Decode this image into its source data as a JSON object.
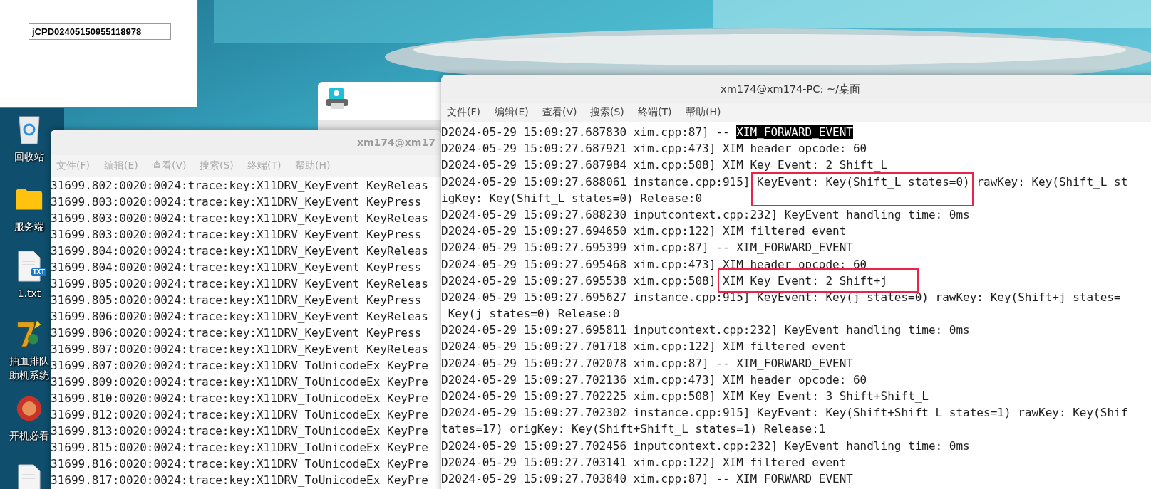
{
  "background_window": {
    "field": {
      "value": "jCPD02405150955118978"
    }
  },
  "desktop_icons": [
    {
      "kind": "trash",
      "label_lines": [
        "回收站"
      ]
    },
    {
      "kind": "folder",
      "label_lines": [
        "服务端"
      ]
    },
    {
      "kind": "txt",
      "badge": "TXT",
      "label_lines": [
        "1.txt"
      ]
    },
    {
      "kind": "app",
      "label_lines": [
        "抽血排队",
        "助机系统"
      ]
    },
    {
      "kind": "badge",
      "label_lines": [
        "开机必看"
      ]
    },
    {
      "kind": "txt"
    }
  ],
  "terminals": [
    {
      "title": "xm174@xm17",
      "active": false,
      "menu": [
        "文件(F)",
        "编辑(E)",
        "查看(V)",
        "搜索(S)",
        "终端(T)",
        "帮助(H)"
      ],
      "lines": [
        {
          "text": "31699.802:0020:0024:trace:key:X11DRV_KeyEvent KeyReleas"
        },
        {
          "text": "31699.803:0020:0024:trace:key:X11DRV_KeyEvent KeyPress"
        },
        {
          "text": "31699.803:0020:0024:trace:key:X11DRV_KeyEvent KeyReleas"
        },
        {
          "text": "31699.803:0020:0024:trace:key:X11DRV_KeyEvent KeyPress"
        },
        {
          "text": "31699.804:0020:0024:trace:key:X11DRV_KeyEvent KeyReleas"
        },
        {
          "text": "31699.804:0020:0024:trace:key:X11DRV_KeyEvent KeyPress"
        },
        {
          "text": "31699.805:0020:0024:trace:key:X11DRV_KeyEvent KeyReleas"
        },
        {
          "text": "31699.805:0020:0024:trace:key:X11DRV_KeyEvent KeyPress"
        },
        {
          "text": "31699.806:0020:0024:trace:key:X11DRV_KeyEvent KeyReleas"
        },
        {
          "text": "31699.806:0020:0024:trace:key:X11DRV_KeyEvent KeyPress"
        },
        {
          "text": "31699.807:0020:0024:trace:key:X11DRV_KeyEvent KeyReleas"
        },
        {
          "text": "31699.807:0020:0024:trace:key:X11DRV_ToUnicodeEx KeyPre"
        },
        {
          "text": "31699.809:0020:0024:trace:key:X11DRV_ToUnicodeEx KeyPre"
        },
        {
          "text": "31699.810:0020:0024:trace:key:X11DRV_ToUnicodeEx KeyPre"
        },
        {
          "text": "31699.812:0020:0024:trace:key:X11DRV_ToUnicodeEx KeyPre"
        },
        {
          "text": "31699.813:0020:0024:trace:key:X11DRV_ToUnicodeEx KeyPre"
        },
        {
          "text": "31699.815:0020:0024:trace:key:X11DRV_ToUnicodeEx KeyPre"
        },
        {
          "text": "31699.816:0020:0024:trace:key:X11DRV_ToUnicodeEx KeyPre"
        },
        {
          "text": "31699.817:0020:0024:trace:key:X11DRV_ToUnicodeEx KeyPre"
        }
      ]
    },
    {
      "title": "xm174@xm174-PC: ~/桌面",
      "active": true,
      "menu": [
        "文件(F)",
        "编辑(E)",
        "查看(V)",
        "搜索(S)",
        "终端(T)",
        "帮助(H)"
      ],
      "lines": [
        {
          "text": "D2024-05-29 15:09:27.687830 xim.cpp:87] -- ",
          "selection": "XIM_FORWARD_EVENT"
        },
        {
          "text": "D2024-05-29 15:09:27.687921 xim.cpp:473] XIM header opcode: 60"
        },
        {
          "text": "D2024-05-29 15:09:27.687984 xim.cpp:508] XIM Key Event: 2 Shift_L"
        },
        {
          "text": "D2024-05-29 15:09:27.688061 instance.cpp:915] KeyEvent: Key(Shift_L states=0) rawKey: Key(Shift_L st"
        },
        {
          "text": "igKey: Key(Shift_L states=0) Release:0"
        },
        {
          "text": "D2024-05-29 15:09:27.688230 inputcontext.cpp:232] KeyEvent handling time: 0ms"
        },
        {
          "text": "D2024-05-29 15:09:27.694650 xim.cpp:122] XIM filtered event"
        },
        {
          "text": "D2024-05-29 15:09:27.695399 xim.cpp:87] -- XIM_FORWARD_EVENT"
        },
        {
          "text": "D2024-05-29 15:09:27.695468 xim.cpp:473] XIM header opcode: 60"
        },
        {
          "text": "D2024-05-29 15:09:27.695538 xim.cpp:508] XIM Key Event: 2 Shift+j"
        },
        {
          "text": "D2024-05-29 15:09:27.695627 instance.cpp:915] KeyEvent: Key(j states=0) rawKey: Key(Shift+j states="
        },
        {
          "text": " Key(j states=0) Release:0"
        },
        {
          "text": "D2024-05-29 15:09:27.695811 inputcontext.cpp:232] KeyEvent handling time: 0ms"
        },
        {
          "text": "D2024-05-29 15:09:27.701718 xim.cpp:122] XIM filtered event"
        },
        {
          "text": "D2024-05-29 15:09:27.702078 xim.cpp:87] -- XIM_FORWARD_EVENT"
        },
        {
          "text": "D2024-05-29 15:09:27.702136 xim.cpp:473] XIM header opcode: 60"
        },
        {
          "text": "D2024-05-29 15:09:27.702225 xim.cpp:508] XIM Key Event: 3 Shift+Shift_L"
        },
        {
          "text": "D2024-05-29 15:09:27.702302 instance.cpp:915] KeyEvent: Key(Shift+Shift_L states=1) rawKey: Key(Shif"
        },
        {
          "text": "tates=17) origKey: Key(Shift+Shift_L states=1) Release:1"
        },
        {
          "text": "D2024-05-29 15:09:27.702456 inputcontext.cpp:232] KeyEvent handling time: 0ms"
        },
        {
          "text": "D2024-05-29 15:09:27.703141 xim.cpp:122] XIM filtered event"
        },
        {
          "text": "D2024-05-29 15:09:27.703840 xim.cpp:87] -- XIM_FORWARD_EVENT"
        }
      ]
    }
  ]
}
